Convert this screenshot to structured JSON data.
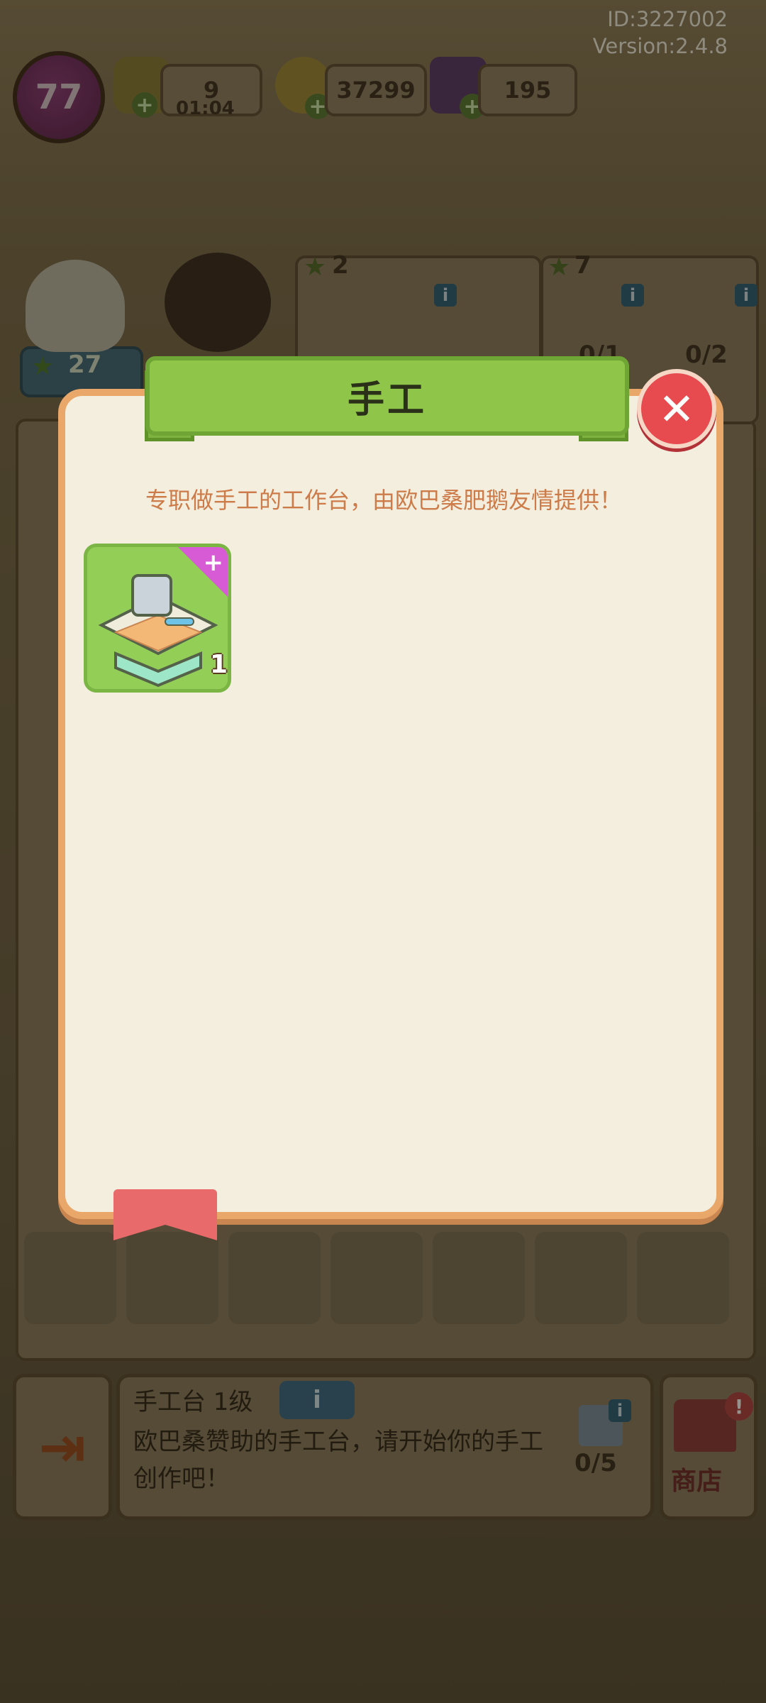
{
  "header": {
    "id_text": "ID:3227002",
    "version_text": "Version:2.4.8",
    "level": "77",
    "energy": "9",
    "energy_timer": "01:04",
    "coins": "37299",
    "gems": "195"
  },
  "background": {
    "worker_stars": "27",
    "slot1_stars": "2",
    "slot2_stars": "7",
    "slot1_progress": "0/1",
    "slot2_progress": "0/2"
  },
  "modal": {
    "title": "手工",
    "description": "专职做手工的工作台，由欧巴桑肥鹅友情提供！",
    "items": [
      {
        "count": "1",
        "icon": "craft-table-icon"
      }
    ]
  },
  "bottom": {
    "title": "手工台 1级",
    "info_label": "i",
    "description": "欧巴桑赞助的手工台，请开始你的手工创作吧！",
    "progress": "0/5",
    "shop_label": "商店"
  },
  "colors": {
    "modal_bg": "#f4eedf",
    "modal_border": "#e9a86a",
    "banner_green": "#8fc64a",
    "close_red": "#e74a4f",
    "description_text": "#cc7b49",
    "item_card_green": "#93cf57",
    "tag_pink": "#d85bd6"
  }
}
